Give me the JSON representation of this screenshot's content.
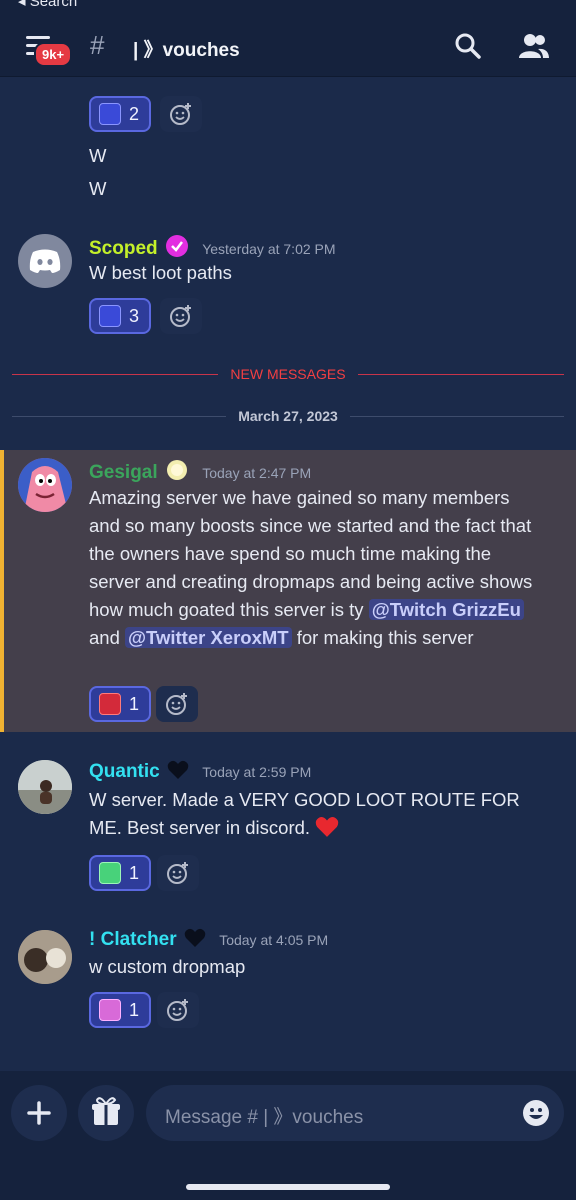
{
  "status_bar": {
    "back_label": "◂ Search"
  },
  "header": {
    "badge": "9k+",
    "hash": "#",
    "channel": "| 》vouches"
  },
  "messages": [
    {
      "fragments": [
        "W",
        "W"
      ],
      "reactions": [
        {
          "count": "2"
        }
      ]
    },
    {
      "author": "Scoped",
      "time": "Yesterday at 7:02 PM",
      "text": "W best loot paths",
      "reactions": [
        {
          "count": "3"
        }
      ]
    },
    {
      "author": "Gesigal",
      "time": "Today at 2:47 PM",
      "text_before": "Amazing server we have gained so many members and so many boosts  since we started and the fact that the owners have spend so much time making the server and creating dropmaps and being active shows how much goated this server is ty ",
      "mention1": "@Twitch GrizzEu",
      "text_middle": "  and ",
      "mention2": "@Twitter XeroxMT",
      "text_after": "   for making this server",
      "reactions": [
        {
          "count": "1"
        }
      ]
    },
    {
      "author": "Quantic",
      "time": "Today at 2:59 PM",
      "text": "W server. Made a VERY GOOD LOOT ROUTE FOR ME. Best server in discord.",
      "reactions": [
        {
          "count": "1"
        }
      ]
    },
    {
      "author": "! Clatcher",
      "time": "Today at 4:05 PM",
      "text": "w custom dropmap",
      "reactions": [
        {
          "count": "1"
        }
      ]
    }
  ],
  "dividers": {
    "new_messages": "NEW MESSAGES",
    "date": "March 27, 2023"
  },
  "composer": {
    "placeholder": "Message # | 》vouches"
  },
  "colors": {
    "background": "#1b2a4a",
    "header": "#15223d",
    "scoped": "#c4f02a",
    "gesigal": "#3ba55c",
    "quantic": "#33e0f0",
    "clatcher": "#33e0f0",
    "new_messages": "#f23f42",
    "highlight_bar": "#f0b232"
  },
  "icons": [
    "back-icon",
    "menu-icon",
    "hash-icon",
    "search-icon",
    "members-icon",
    "verified-icon",
    "heart-icon",
    "add-reaction-icon",
    "plus-icon",
    "gift-icon",
    "emoji-icon"
  ]
}
